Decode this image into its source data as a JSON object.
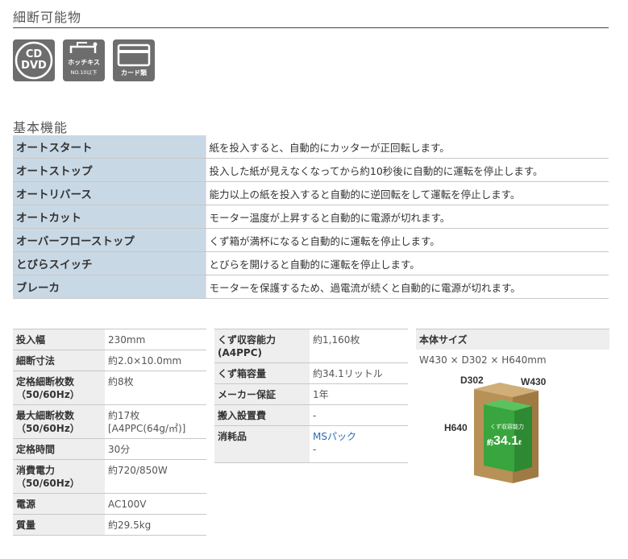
{
  "shred_section": {
    "title": "細断可能物",
    "icons": {
      "cd_line1": "CD",
      "cd_line2": "DVD",
      "staple_label": "ホッチキス",
      "staple_sub": "NO.10以下",
      "card_label": "カード類"
    }
  },
  "basic_section": {
    "title": "基本機能",
    "rows": [
      {
        "feature": "オートスタート",
        "desc": "紙を投入すると、自動的にカッターが正回転します。"
      },
      {
        "feature": "オートストップ",
        "desc": "投入した紙が見えなくなってから約10秒後に自動的に運転を停止します。"
      },
      {
        "feature": "オートリバース",
        "desc": "能力以上の紙を投入すると自動的に逆回転をして運転を停止します。"
      },
      {
        "feature": "オートカット",
        "desc": "モーター温度が上昇すると自動的に電源が切れます。"
      },
      {
        "feature": "オーバーフローストップ",
        "desc": "くず箱が満杯になると自動的に運転を停止します。"
      },
      {
        "feature": "とびらスイッチ",
        "desc": "とびらを開けると自動的に運転を停止します。"
      },
      {
        "feature": "ブレーカ",
        "desc": "モーターを保護するため、過電流が続くと自動的に電源が切れます。"
      }
    ]
  },
  "specs_left": [
    {
      "key": "投入幅",
      "value": "230mm"
    },
    {
      "key": "細断寸法",
      "value": "約2.0×10.0mm"
    },
    {
      "key": "定格細断枚数",
      "key2": "（50/60Hz）",
      "value": "約8枚"
    },
    {
      "key": "最大細断枚数",
      "key2": "（50/60Hz）",
      "value": "約17枚",
      "value2": "[A4PPC(64g/㎡)]"
    },
    {
      "key": "定格時間",
      "value": "30分"
    },
    {
      "key": "消費電力",
      "key2": "（50/60Hz）",
      "value": "約720/850W"
    },
    {
      "key": "電源",
      "value": "AC100V"
    },
    {
      "key": "質量",
      "value": "約29.5kg"
    }
  ],
  "specs_mid": [
    {
      "key": "くず収容能力",
      "key2": "(A4PPC)",
      "value": "約1,160枚"
    },
    {
      "key": "くず箱容量",
      "value": "約34.1リットル"
    },
    {
      "key": "メーカー保証",
      "value": "1年"
    },
    {
      "key": "搬入設置費",
      "value": "-"
    },
    {
      "key": "消耗品",
      "value_link": "MSパック",
      "value2": "-"
    }
  ],
  "body_size": {
    "title": "本体サイズ",
    "text": "W430 × D302 × H640mm",
    "label_d": "D302",
    "label_w": "W430",
    "label_h": "H640",
    "badge_line1": "くず収容能力",
    "badge_prefix": "約",
    "badge_value": "34.1",
    "badge_unit": "ℓ"
  },
  "colors": {
    "box_brown": "#b89156",
    "bin_green": "#39a53e",
    "feature_bg": "#c9d8e5",
    "tile_gray": "#6d6d6d"
  }
}
